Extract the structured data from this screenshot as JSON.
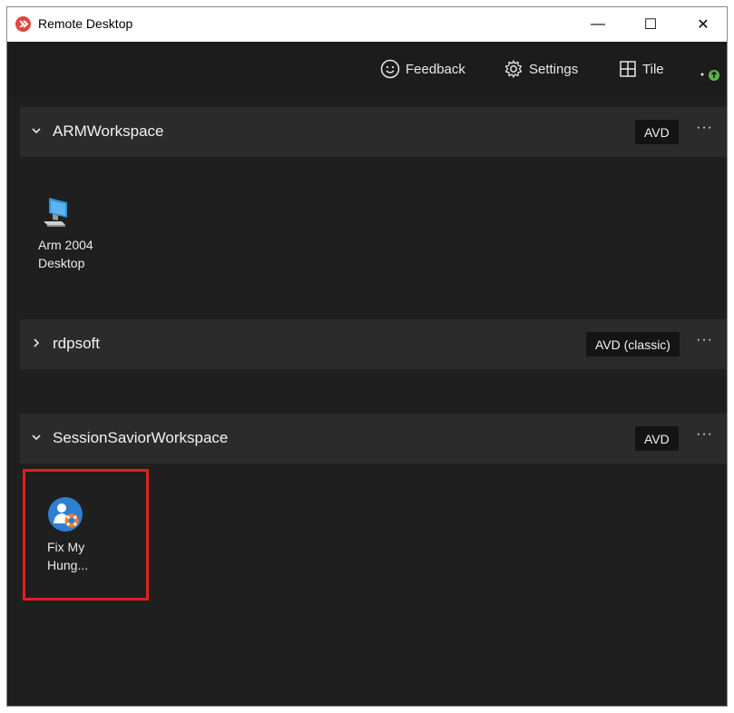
{
  "window": {
    "title": "Remote Desktop",
    "controls": {
      "minimize": "—",
      "maximize": "☐",
      "close": "✕"
    }
  },
  "toolbar": {
    "feedback": "Feedback",
    "settings": "Settings",
    "tile": "Tile"
  },
  "workspaces": [
    {
      "name": "ARMWorkspace",
      "badge": "AVD",
      "expanded": true,
      "resources": [
        {
          "label_line1": "Arm 2004",
          "label_line2": "Desktop",
          "icon": "desktop-icon"
        }
      ]
    },
    {
      "name": "rdpsoft",
      "badge": "AVD (classic)",
      "expanded": false,
      "resources": []
    },
    {
      "name": "SessionSaviorWorkspace",
      "badge": "AVD",
      "expanded": true,
      "resources": [
        {
          "label_line1": "Fix My",
          "label_line2": "Hung...",
          "icon": "lifebuoy-user-icon"
        }
      ]
    }
  ],
  "menu_glyph": "···",
  "colors": {
    "background": "#1f1f1f",
    "section": "#2b2b2b",
    "highlight": "#e12020",
    "app_icon": "#e2453a"
  }
}
